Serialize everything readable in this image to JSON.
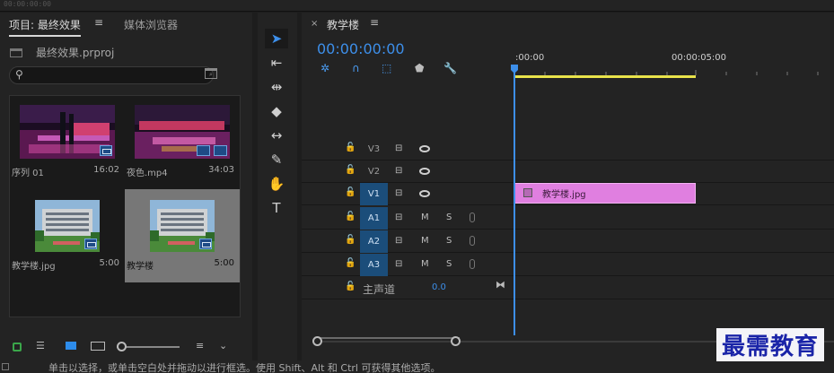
{
  "top_bar": {
    "timecode": "00:00:00:00"
  },
  "project_panel": {
    "tab_label": "项目: 最终效果",
    "menu_icon": "≡",
    "media_browser_tab": "媒体浏览器",
    "project_file": "最终效果.prproj",
    "search": {
      "value": "",
      "placeholder": ""
    },
    "items": [
      {
        "name": "序列 01",
        "duration": "16:02",
        "kind": "sequence"
      },
      {
        "name": "夜色.mp4",
        "duration": "34:03",
        "kind": "video"
      },
      {
        "name": "教学楼.jpg",
        "duration": "5:00",
        "kind": "image"
      },
      {
        "name": "教学楼",
        "duration": "5:00",
        "kind": "sequence",
        "selected": true
      }
    ]
  },
  "tools": [
    "selection-tool",
    "track-select-tool",
    "ripple-edit-tool",
    "razor-tool",
    "slip-tool",
    "pen-tool",
    "hand-tool",
    "type-tool"
  ],
  "timeline": {
    "sequence_name": "教学楼",
    "menu_icon": "≡",
    "timecode": "00:00:00:00",
    "ruler": {
      "start": ":00:00",
      "mark": "00:00:05:00"
    },
    "video_tracks": [
      {
        "label": "V3",
        "targeted": false
      },
      {
        "label": "V2",
        "targeted": false
      },
      {
        "label": "V1",
        "targeted": true
      }
    ],
    "audio_tracks": [
      {
        "label": "A1",
        "mute": "M",
        "solo": "S"
      },
      {
        "label": "A2",
        "mute": "M",
        "solo": "S"
      },
      {
        "label": "A3",
        "mute": "M",
        "solo": "S"
      }
    ],
    "master": {
      "label": "主声道",
      "value": "0.0"
    },
    "clip": {
      "name": "教学楼.jpg",
      "color": "#e07fe0",
      "track": "V1"
    }
  },
  "status_bar": {
    "text": "单击以选择，或单击空白处并拖动以进行框选。使用 Shift、Alt 和 Ctrl 可获得其他选项。"
  },
  "watermark": "最需教育",
  "colors": {
    "accent": "#3d8fea",
    "work_area": "#e8e24a",
    "clip": "#e07fe0",
    "track_target": "#1b4d7a"
  }
}
